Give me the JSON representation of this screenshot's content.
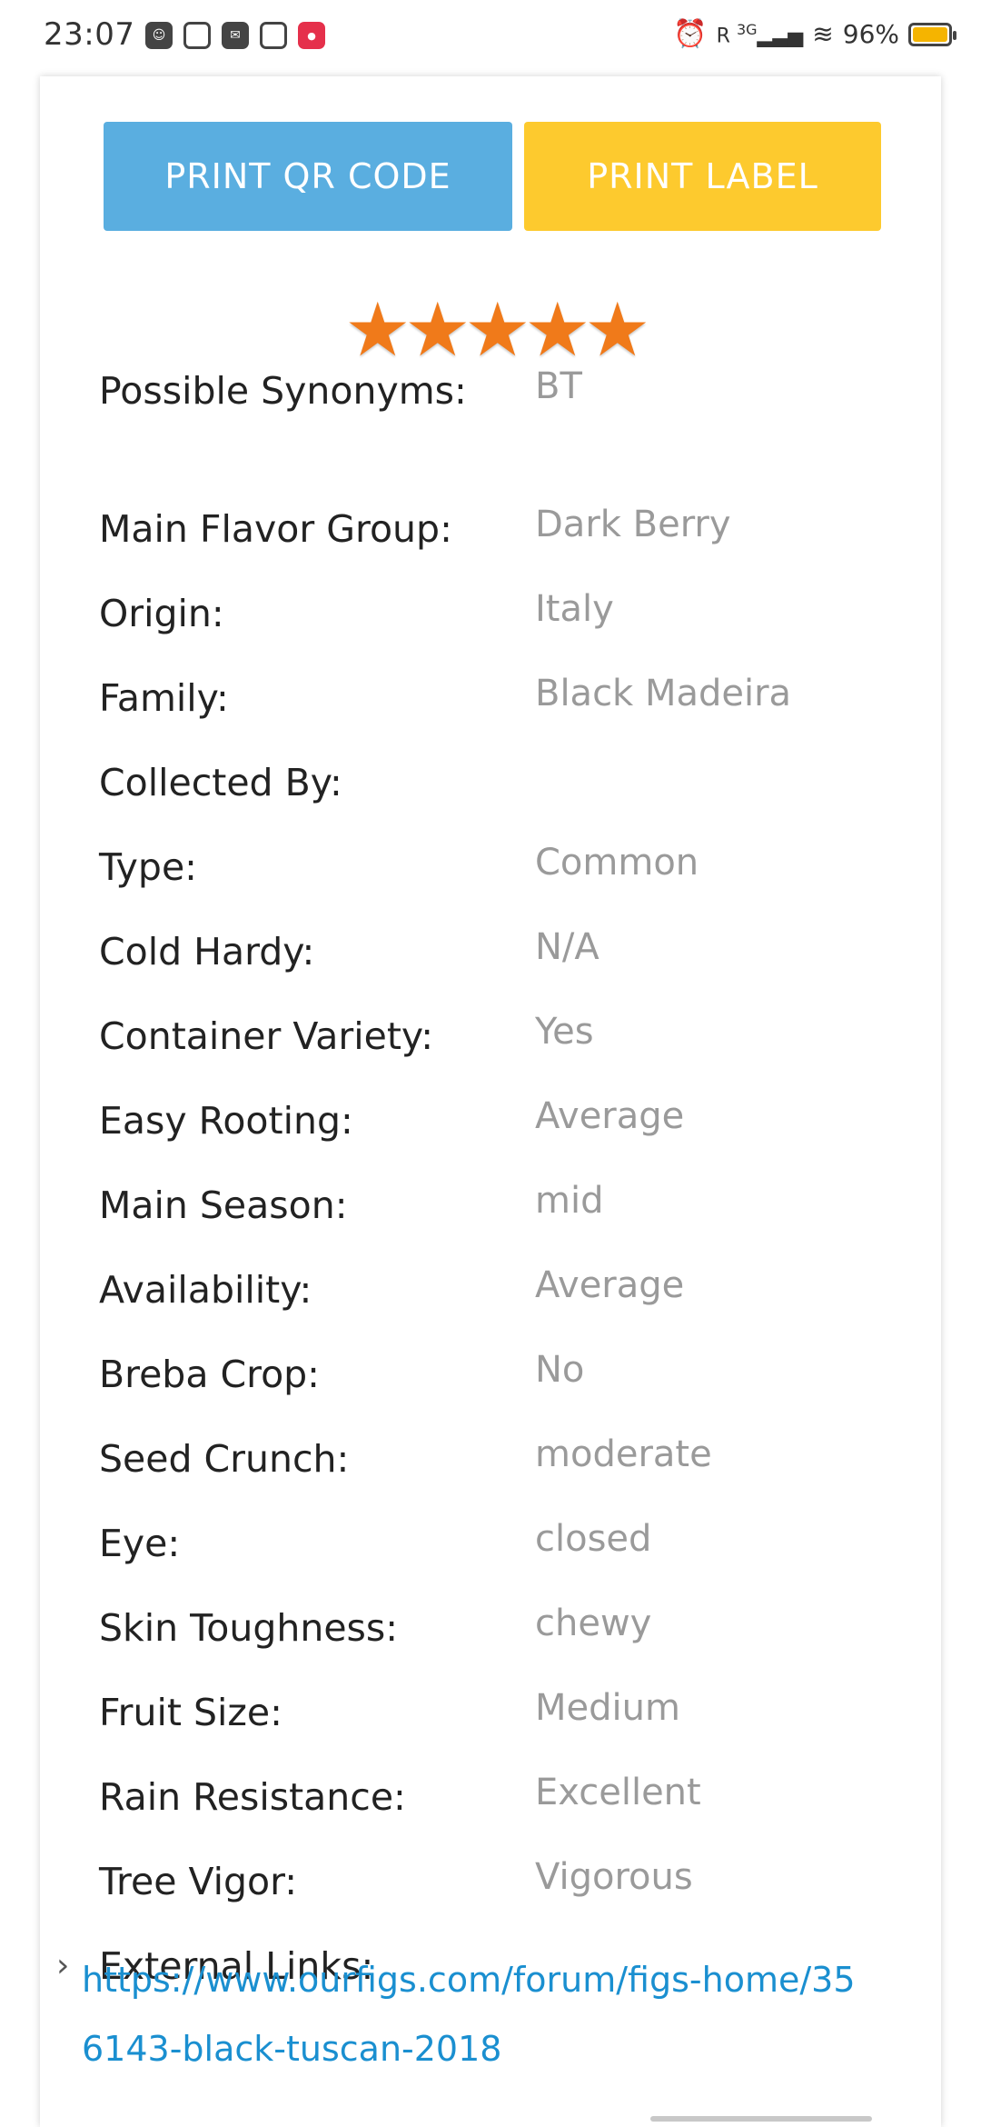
{
  "status_bar": {
    "time": "23:07",
    "network": "3G",
    "battery_percent": "96%",
    "icons_left": [
      "robot-icon",
      "wallet-icon",
      "mail-icon",
      "leaf-icon",
      "app-red-icon"
    ],
    "icons_right": [
      "alarm-icon",
      "signal-icon",
      "wifi-icon",
      "battery-icon"
    ]
  },
  "buttons": {
    "print_qr": "PRINT QR CODE",
    "print_label": "PRINT LABEL"
  },
  "rating": {
    "stars": 5,
    "max": 5,
    "color": "#f07a1a"
  },
  "details": [
    {
      "label": "Possible Synonyms:",
      "value": "BT"
    },
    {
      "label": "Main Flavor Group:",
      "value": "Dark Berry"
    },
    {
      "label": "Origin:",
      "value": "Italy"
    },
    {
      "label": "Family:",
      "value": "Black Madeira"
    },
    {
      "label": "Collected By:",
      "value": ""
    },
    {
      "label": "Type:",
      "value": "Common"
    },
    {
      "label": "Cold Hardy:",
      "value": "N/A"
    },
    {
      "label": "Container Variety:",
      "value": "Yes"
    },
    {
      "label": "Easy Rooting:",
      "value": "Average"
    },
    {
      "label": "Main Season:",
      "value": "mid"
    },
    {
      "label": "Availability:",
      "value": "Average"
    },
    {
      "label": "Breba Crop:",
      "value": "No"
    },
    {
      "label": "Seed Crunch:",
      "value": "moderate"
    },
    {
      "label": "Eye:",
      "value": "closed"
    },
    {
      "label": "Skin Toughness:",
      "value": "chewy"
    },
    {
      "label": "Fruit Size:",
      "value": "Medium"
    },
    {
      "label": "Rain Resistance:",
      "value": "Excellent"
    },
    {
      "label": "Tree Vigor:",
      "value": "Vigorous"
    }
  ],
  "external_links": {
    "label": "External Links:",
    "links": [
      "https://www.ourfigs.com/forum/figs-home/356143-black-tuscan-2018"
    ]
  },
  "colors": {
    "qr_button": "#5aaee0",
    "label_button": "#fdca2e",
    "link": "#1a8fd0",
    "value_text": "#9a9a9a"
  }
}
